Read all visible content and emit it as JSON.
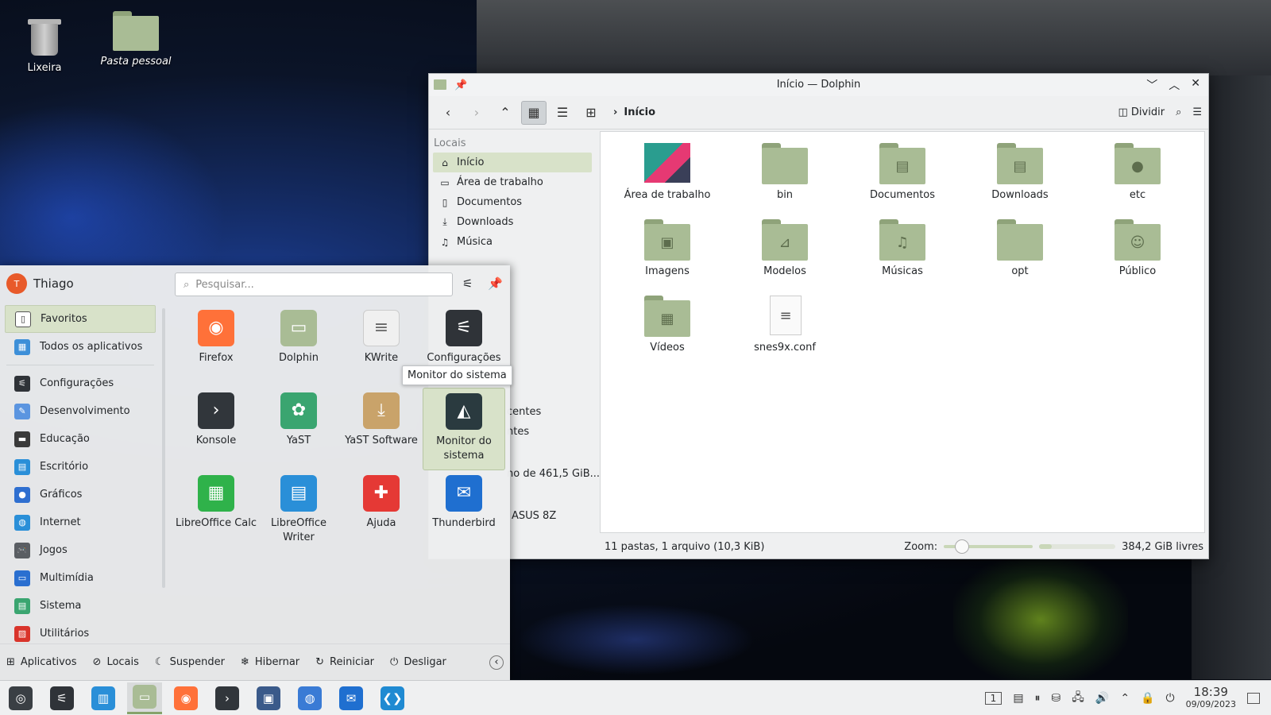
{
  "desktop": {
    "icons": [
      {
        "label": "Lixeira"
      },
      {
        "label": "Pasta pessoal"
      }
    ]
  },
  "dolphin": {
    "title": "Início — Dolphin",
    "breadcrumb": "Início",
    "split_label": "Dividir",
    "places_header": "Locais",
    "places": [
      {
        "label": "Início",
        "icon": "home-icon"
      },
      {
        "label": "Área de trabalho",
        "icon": "desktop-icon"
      },
      {
        "label": "Documentos",
        "icon": "documents-icon"
      },
      {
        "label": "Downloads",
        "icon": "download-icon"
      },
      {
        "label": "Música",
        "icon": "music-icon"
      }
    ],
    "sidebar_fragments": [
      "centes",
      "ntes",
      "no de 461,5 GiB...",
      "ASUS 8Z"
    ],
    "files": [
      {
        "name": "Área de trabalho",
        "kind": "desktop"
      },
      {
        "name": "bin",
        "kind": "folder"
      },
      {
        "name": "Documentos",
        "kind": "folder"
      },
      {
        "name": "Downloads",
        "kind": "folder"
      },
      {
        "name": "etc",
        "kind": "folder"
      },
      {
        "name": "Imagens",
        "kind": "folder"
      },
      {
        "name": "Modelos",
        "kind": "folder"
      },
      {
        "name": "Músicas",
        "kind": "folder"
      },
      {
        "name": "opt",
        "kind": "folder"
      },
      {
        "name": "Público",
        "kind": "folder"
      },
      {
        "name": "Vídeos",
        "kind": "folder"
      },
      {
        "name": "snes9x.conf",
        "kind": "file"
      }
    ],
    "status": "11 pastas, 1 arquivo (10,3 KiB)",
    "zoom_label": "Zoom:",
    "zoom_level": 0.2,
    "free_space": "384,2 GiB livres",
    "used_fraction": 0.17
  },
  "launcher": {
    "user": "Thiago",
    "avatar_letter": "T",
    "search_placeholder": "Pesquisar...",
    "categories": [
      {
        "label": "Favoritos",
        "color": "#ffffff"
      },
      {
        "label": "Todos os aplicativos",
        "color": "#3d8fd8"
      },
      {
        "label": "Configurações",
        "color": "#2f3338"
      },
      {
        "label": "Desenvolvimento",
        "color": "#5b95e0"
      },
      {
        "label": "Educação",
        "color": "#3a3a3a"
      },
      {
        "label": "Escritório",
        "color": "#2a8fd8"
      },
      {
        "label": "Gráficos",
        "color": "#2f6fd0"
      },
      {
        "label": "Internet",
        "color": "#2a8fd8"
      },
      {
        "label": "Jogos",
        "color": "#5a5e63"
      },
      {
        "label": "Multimídia",
        "color": "#2a6fd0"
      },
      {
        "label": "Sistema",
        "color": "#3aa570"
      },
      {
        "label": "Utilitários",
        "color": "#d9342b"
      }
    ],
    "apps": [
      {
        "label": "Firefox",
        "color": "#ff7139"
      },
      {
        "label": "Dolphin",
        "color": "#a9bc95"
      },
      {
        "label": "KWrite",
        "color": "#f0f0f0"
      },
      {
        "label": "Configurações",
        "color": "#2f3338"
      },
      {
        "label": "Konsole",
        "color": "#31363b"
      },
      {
        "label": "YaST",
        "color": "#3aa570"
      },
      {
        "label": "YaST Software",
        "color": "#c9a36a"
      },
      {
        "label": "Monitor do sistema",
        "color": "#2a3a3f"
      },
      {
        "label": "LibreOffice Calc",
        "color": "#2fb24a"
      },
      {
        "label": "LibreOffice Writer",
        "color": "#2a8fd8"
      },
      {
        "label": "Ajuda",
        "color": "#e53935"
      },
      {
        "label": "Thunderbird",
        "color": "#1f6fd0"
      }
    ],
    "tooltip": "Monitor do sistema",
    "footer": [
      {
        "label": "Aplicativos",
        "icon": "grid-icon"
      },
      {
        "label": "Locais",
        "icon": "compass-icon"
      },
      {
        "label": "Suspender",
        "icon": "moon-icon"
      },
      {
        "label": "Hibernar",
        "icon": "snowflake-icon"
      },
      {
        "label": "Reiniciar",
        "icon": "restart-icon"
      },
      {
        "label": "Desligar",
        "icon": "power-icon"
      }
    ]
  },
  "taskbar": {
    "apps": [
      {
        "name": "launcher",
        "color": "#3a3f44"
      },
      {
        "name": "settings",
        "color": "#2f3338"
      },
      {
        "name": "discover",
        "color": "#2a8fd8"
      },
      {
        "name": "dolphin",
        "color": "#a9bc95"
      },
      {
        "name": "firefox",
        "color": "#ff7139"
      },
      {
        "name": "konsole",
        "color": "#31363b"
      },
      {
        "name": "spectacle",
        "color": "#3a5a8a"
      },
      {
        "name": "chromium",
        "color": "#3a7bd5"
      },
      {
        "name": "thunderbird",
        "color": "#1f6fd0"
      },
      {
        "name": "vscode",
        "color": "#1f8ad2"
      }
    ],
    "pager": "1",
    "time": "18:39",
    "date": "09/09/2023"
  }
}
